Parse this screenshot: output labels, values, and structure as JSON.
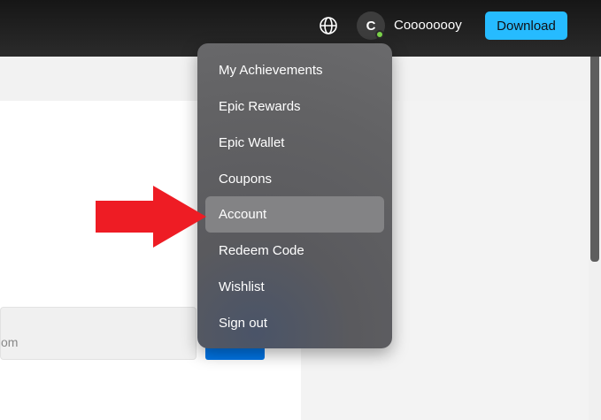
{
  "header": {
    "globe_icon": "globe-icon",
    "avatar_initial": "C",
    "username": "Coooooooy",
    "download_label": "Download",
    "download_color": "#26bbff"
  },
  "main": {
    "email_partial": "om"
  },
  "menu": {
    "items": [
      {
        "label": "My Achievements"
      },
      {
        "label": "Epic Rewards"
      },
      {
        "label": "Epic Wallet"
      },
      {
        "label": "Coupons"
      },
      {
        "label": "Account",
        "highlighted": true
      },
      {
        "label": "Redeem Code"
      },
      {
        "label": "Wishlist"
      },
      {
        "label": "Sign out"
      }
    ]
  },
  "annotation": {
    "arrow_color": "#ee1c24",
    "arrow_target": "Account"
  }
}
